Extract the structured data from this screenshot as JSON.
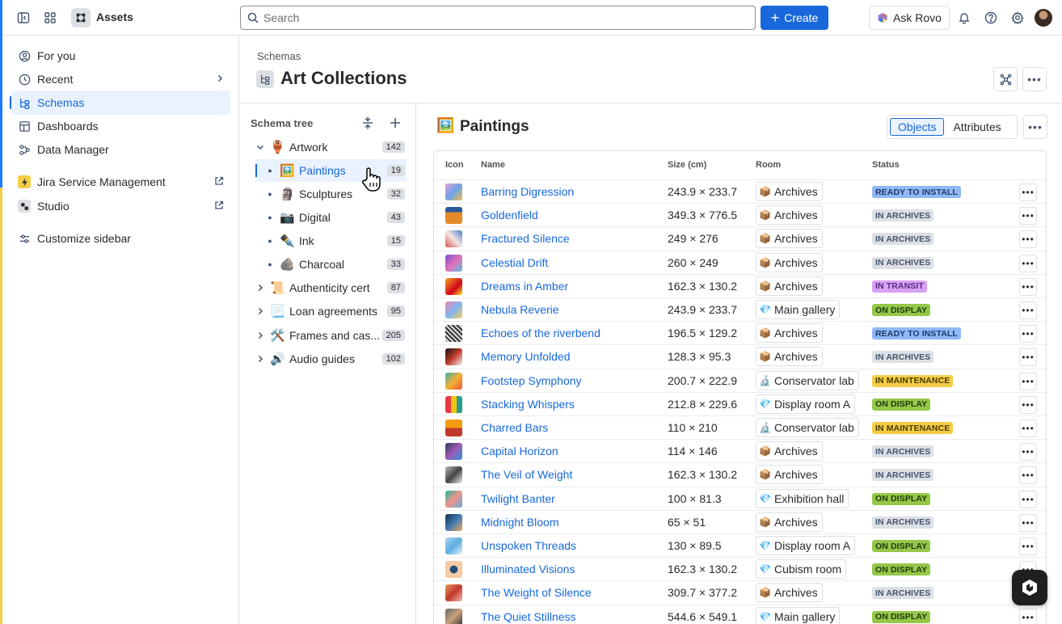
{
  "topbar": {
    "app_name": "Assets",
    "search_placeholder": "Search",
    "create_label": "Create",
    "rovo_label": "Ask Rovo"
  },
  "sidebar": {
    "items": [
      {
        "label": "For you",
        "icon": "user-circle-icon"
      },
      {
        "label": "Recent",
        "icon": "clock-icon"
      },
      {
        "label": "Schemas",
        "icon": "schema-icon",
        "active": true
      },
      {
        "label": "Dashboards",
        "icon": "dashboard-icon"
      },
      {
        "label": "Data Manager",
        "icon": "data-manager-icon"
      },
      {
        "label": "Jira Service Management",
        "icon": "jsm-icon"
      },
      {
        "label": "Studio",
        "icon": "studio-icon"
      },
      {
        "label": "Customize sidebar",
        "icon": "sliders-icon"
      }
    ]
  },
  "header": {
    "breadcrumb": "Schemas",
    "title": "Art Collections"
  },
  "tree": {
    "title": "Schema tree",
    "nodes": [
      {
        "emoji": "🏺",
        "label": "Artwork",
        "count": "142",
        "expanded": true
      },
      {
        "emoji": "🖼️",
        "label": "Paintings",
        "count": "19",
        "active": true
      },
      {
        "emoji": "🗿",
        "label": "Sculptures",
        "count": "32"
      },
      {
        "emoji": "📷",
        "label": "Digital",
        "count": "43"
      },
      {
        "emoji": "✒️",
        "label": "Ink",
        "count": "15"
      },
      {
        "emoji": "🪨",
        "label": "Charcoal",
        "count": "33"
      },
      {
        "emoji": "📜",
        "label": "Authenticity cert",
        "count": "87"
      },
      {
        "emoji": "📃",
        "label": "Loan agreements",
        "count": "95"
      },
      {
        "emoji": "🛠️",
        "label": "Frames and cas...",
        "count": "205"
      },
      {
        "emoji": "🔊",
        "label": "Audio guides",
        "count": "102"
      }
    ]
  },
  "object_panel": {
    "emoji": "🖼️",
    "title": "Paintings",
    "tabs": [
      "Objects",
      "Attributes"
    ],
    "columns": [
      "Icon",
      "Name",
      "Size (cm)",
      "Room",
      "Status"
    ]
  },
  "rows": [
    {
      "name": "Barring Digression",
      "size": "243.9 × 233.7",
      "room_icon": "📦",
      "room": "Archives",
      "status": "READY TO INSTALL"
    },
    {
      "name": "Goldenfield",
      "size": "349.3 × 776.5",
      "room_icon": "📦",
      "room": "Archives",
      "status": "IN ARCHIVES"
    },
    {
      "name": "Fractured Silence",
      "size": "249 × 276",
      "room_icon": "📦",
      "room": "Archives",
      "status": "IN ARCHIVES"
    },
    {
      "name": "Celestial Drift",
      "size": "260 × 249",
      "room_icon": "📦",
      "room": "Archives",
      "status": "IN ARCHIVES"
    },
    {
      "name": "Dreams in Amber",
      "size": "162.3 × 130.2",
      "room_icon": "📦",
      "room": "Archives",
      "status": "IN TRANSIT"
    },
    {
      "name": "Nebula Reverie",
      "size": "243.9 × 233.7",
      "room_icon": "💎",
      "room": "Main gallery",
      "status": "ON DISPLAY"
    },
    {
      "name": "Echoes of the riverbend",
      "size": "196.5 × 129.2",
      "room_icon": "📦",
      "room": "Archives",
      "status": "READY TO INSTALL"
    },
    {
      "name": "Memory Unfolded",
      "size": "128.3 × 95.3",
      "room_icon": "📦",
      "room": "Archives",
      "status": "IN ARCHIVES"
    },
    {
      "name": "Footstep Symphony",
      "size": "200.7 × 222.9",
      "room_icon": "🔬",
      "room": "Conservator lab",
      "status": "IN MAINTENANCE"
    },
    {
      "name": "Stacking Whispers",
      "size": "212.8 × 229.6",
      "room_icon": "💎",
      "room": "Display room A",
      "status": "ON DISPLAY"
    },
    {
      "name": "Charred Bars",
      "size": "110 × 210",
      "room_icon": "🔬",
      "room": "Conservator lab",
      "status": "IN MAINTENANCE"
    },
    {
      "name": "Capital Horizon",
      "size": "114 × 146",
      "room_icon": "📦",
      "room": "Archives",
      "status": "IN ARCHIVES"
    },
    {
      "name": "The Veil of Weight",
      "size": "162.3 × 130.2",
      "room_icon": "📦",
      "room": "Archives",
      "status": "IN ARCHIVES"
    },
    {
      "name": "Twilight Banter",
      "size": "100 × 81.3",
      "room_icon": "💎",
      "room": "Exhibition hall",
      "status": "ON DISPLAY"
    },
    {
      "name": "Midnight Bloom",
      "size": "65 × 51",
      "room_icon": "📦",
      "room": "Archives",
      "status": "IN ARCHIVES"
    },
    {
      "name": "Unspoken Threads",
      "size": "130 × 89.5",
      "room_icon": "💎",
      "room": "Display room A",
      "status": "ON DISPLAY"
    },
    {
      "name": "Illuminated Visions",
      "size": "162.3 × 130.2",
      "room_icon": "💎",
      "room": "Cubism room",
      "status": "ON DISPLAY"
    },
    {
      "name": "The Weight of Silence",
      "size": "309.7 × 377.2",
      "room_icon": "📦",
      "room": "Archives",
      "status": "IN ARCHIVES"
    },
    {
      "name": "The Quiet Stillness",
      "size": "544.6 × 549.1",
      "room_icon": "💎",
      "room": "Main gallery",
      "status": "ON DISPLAY"
    }
  ],
  "status_colors": {
    "READY TO INSTALL": {
      "bg": "#8FB8F6",
      "fg": "#1E3A6B"
    },
    "IN ARCHIVES": {
      "bg": "#DCDFE4",
      "fg": "#44546F"
    },
    "IN TRANSIT": {
      "bg": "#D8A0F7",
      "fg": "#5A2A7A"
    },
    "ON DISPLAY": {
      "bg": "#94C748",
      "fg": "#1F3A0F"
    },
    "IN MAINTENANCE": {
      "bg": "#F5CD47",
      "fg": "#4A3A00"
    }
  },
  "colors": {
    "accent": "#1868DB",
    "selected_bg": "#E9F2FE",
    "border": "#DCDFE4"
  }
}
